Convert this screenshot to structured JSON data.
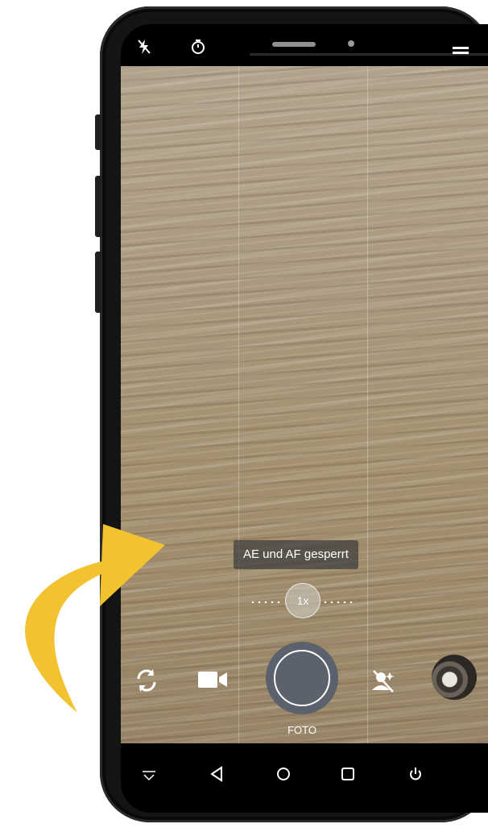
{
  "camera": {
    "lock_message": "AE und AF gesperrt",
    "zoom_label": "1x",
    "mode_label": "FOTO"
  },
  "icons": {
    "statusbar": [
      "flash-off-icon",
      "timer-icon",
      "menu-icon"
    ],
    "controls": [
      "switch-camera-icon",
      "video-icon",
      "shutter-button",
      "ai-off-icon",
      "gallery-thumbnail"
    ],
    "navigation": [
      "collapse-icon",
      "back-icon",
      "home-icon",
      "recents-icon",
      "power-icon"
    ]
  },
  "colors": {
    "arrow": "#f2c230",
    "shutter": "#5b626d",
    "toast_bg": "#3c3c3c"
  }
}
